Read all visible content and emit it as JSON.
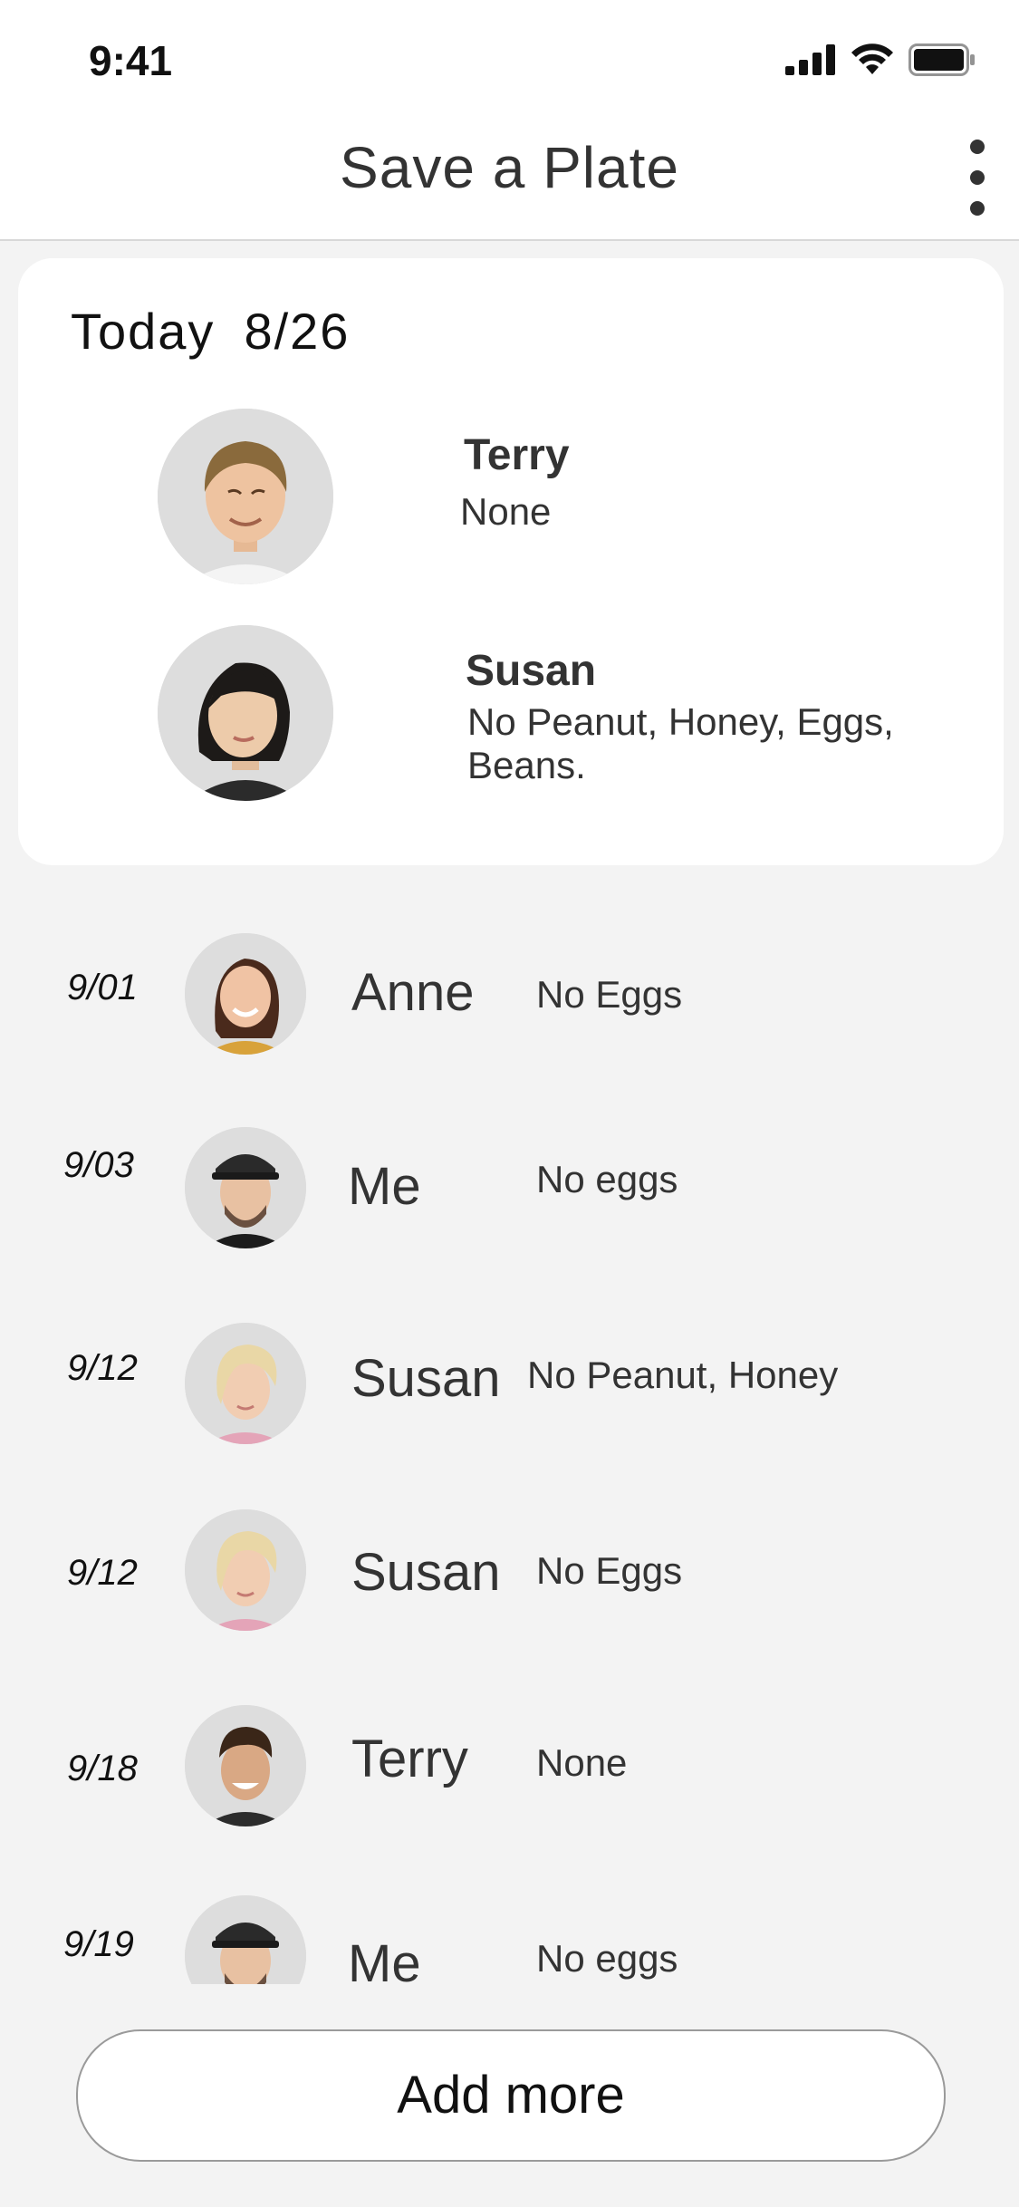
{
  "status_bar": {
    "time": "9:41",
    "icons": [
      "signal-icon",
      "wifi-icon",
      "battery-icon"
    ]
  },
  "header": {
    "title": "Save a Plate",
    "menu_icon": "more-vertical-icon"
  },
  "today": {
    "label": "Today",
    "date": "8/26",
    "people": [
      {
        "name": "Terry",
        "diet": "None"
      },
      {
        "name": "Susan",
        "diet_lines": [
          "No Peanut, Honey, Eggs,",
          "Beans."
        ]
      }
    ]
  },
  "schedule": [
    {
      "date": "9/01",
      "name": "Anne",
      "diet": "No Eggs"
    },
    {
      "date": "9/03",
      "name": "Me",
      "diet": "No eggs"
    },
    {
      "date": "9/12",
      "name": "Susan",
      "diet": "No Peanut, Honey"
    },
    {
      "date": "9/12",
      "name": "Susan",
      "diet": "No Eggs"
    },
    {
      "date": "9/18",
      "name": "Terry",
      "diet": "None"
    },
    {
      "date": "9/19",
      "name": "Me",
      "diet": "No eggs"
    }
  ],
  "actions": {
    "add_more": "Add more"
  }
}
